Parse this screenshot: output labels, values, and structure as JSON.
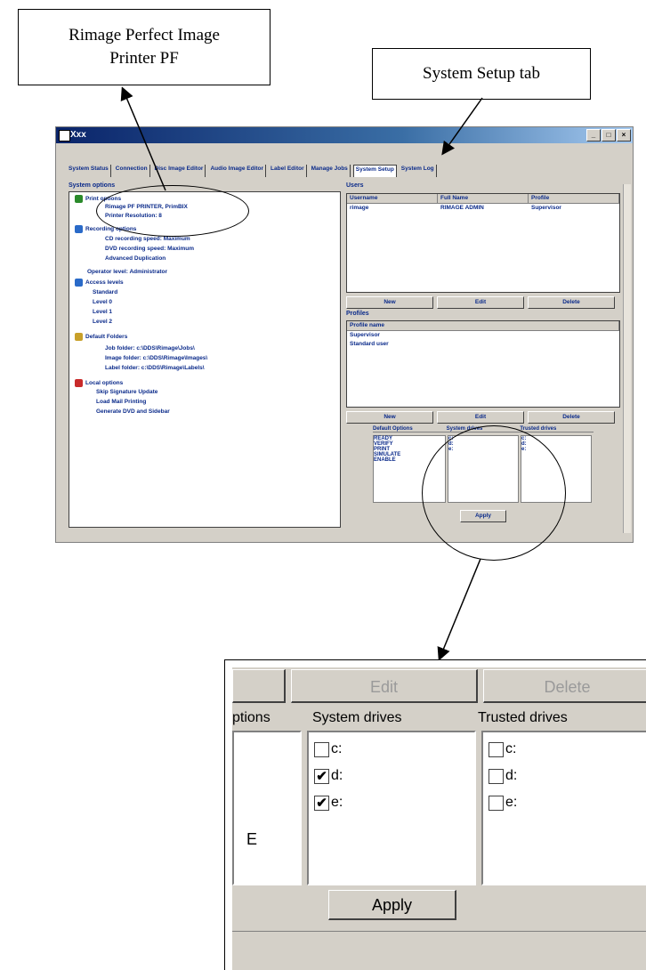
{
  "callouts": {
    "printer_label": "Rimage Perfect Image Printer PF",
    "tab_label": "System Setup tab"
  },
  "window": {
    "title": "Xxx",
    "tabs": [
      "System Status",
      "Connection",
      "Disc Image Editor",
      "Audio Image Editor",
      "Label Editor",
      "Manage Jobs",
      "System Setup",
      "System Log"
    ],
    "left_panel_title": "System options",
    "tree": [
      {
        "label": "Print options",
        "level": 0,
        "color": "#2a8a2a"
      },
      {
        "label": "Rimage PF PRINTER, PrimBIX",
        "level": 1
      },
      {
        "label": "Printer Resolution: 8",
        "level": 1
      },
      {
        "label": "Recording options",
        "level": 0,
        "color": "#2a6ac8"
      },
      {
        "label": "CD recording speed: Maximum",
        "level": 1
      },
      {
        "label": "DVD recording speed: Maximum",
        "level": 1
      },
      {
        "label": "Advanced Duplication",
        "level": 1
      },
      {
        "label": "Operator level: Administrator",
        "level": 0
      },
      {
        "label": "Access levels",
        "level": 0,
        "color": "#2a6ac8"
      },
      {
        "label": "Standard",
        "level": 1
      },
      {
        "label": "Level 0",
        "level": 1
      },
      {
        "label": "Level 1",
        "level": 1
      },
      {
        "label": "Level 2",
        "level": 1
      },
      {
        "label": "Default Folders",
        "level": 0,
        "color": "#c8a02a"
      },
      {
        "label": "Job folder: c:\\DDS\\Rimage\\Jobs\\",
        "level": 1
      },
      {
        "label": "Image folder: c:\\DDS\\Rimage\\Images\\",
        "level": 1
      },
      {
        "label": "Label folder: c:\\DDS\\Rimage\\Labels\\",
        "level": 1
      },
      {
        "label": "Local options",
        "level": 0,
        "color": "#c82a2a"
      },
      {
        "label": "Skip Signature Update",
        "level": 1
      },
      {
        "label": "Load Mail Printing",
        "level": 1
      },
      {
        "label": "Generate DVD and Sidebar",
        "level": 1
      }
    ],
    "users_title": "Users",
    "users_columns": [
      "Username",
      "Full Name",
      "Profile"
    ],
    "users_rows": [
      [
        "rimage",
        "RIMAGE ADMIN",
        "Supervisor"
      ]
    ],
    "user_buttons": [
      "New",
      "Edit",
      "Delete"
    ],
    "profiles_title": "Profiles",
    "profiles_column": "Profile name",
    "profiles_rows": [
      "Supervisor",
      "Standard user"
    ],
    "profile_buttons": [
      "New",
      "Edit",
      "Delete"
    ],
    "drive_columns": [
      "Default Options",
      "System drives",
      "Trusted drives"
    ],
    "drive_options": [
      "READY",
      "VERIFY",
      "PRINT",
      "SIMULATE",
      "ENABLE"
    ],
    "small_drives": [
      "c:",
      "d:",
      "e:"
    ],
    "apply_label": "Apply"
  },
  "zoom": {
    "edit_label": "Edit",
    "delete_label": "Delete",
    "options_header": "ptions",
    "system_drives_header": "System drives",
    "trusted_drives_header": "Trusted drives",
    "partial_option": "E",
    "system_drives": [
      {
        "label": "c:",
        "checked": false
      },
      {
        "label": "d:",
        "checked": true
      },
      {
        "label": "e:",
        "checked": true
      }
    ],
    "trusted_drives": [
      {
        "label": "c:",
        "checked": false
      },
      {
        "label": "d:",
        "checked": false
      },
      {
        "label": "e:",
        "checked": false
      }
    ],
    "apply_label": "Apply"
  }
}
